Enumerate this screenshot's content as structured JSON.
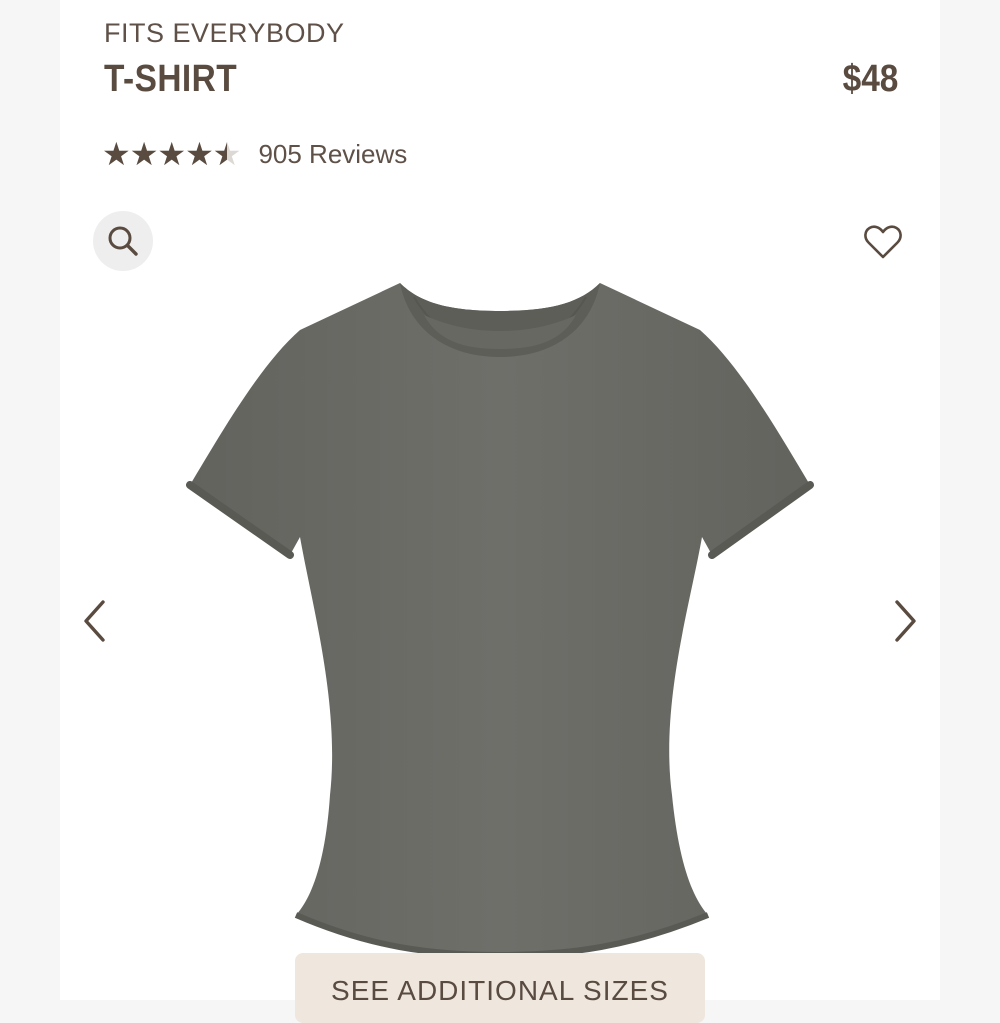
{
  "product": {
    "collection": "FITS EVERYBODY",
    "name": "T-SHIRT",
    "price": "$48",
    "rating": 4.5,
    "max_rating": 5,
    "reviews_label": "905 Reviews",
    "color": "#6b6b66"
  },
  "actions": {
    "sizes_button": "SEE ADDITIONAL SIZES"
  },
  "icons": {
    "search": "search-icon",
    "wishlist": "heart-icon",
    "prev": "chevron-left-icon",
    "next": "chevron-right-icon"
  },
  "theme": {
    "text": "#5a4b40",
    "button_bg": "#efe7de",
    "star_empty": "#dcd8d4"
  }
}
